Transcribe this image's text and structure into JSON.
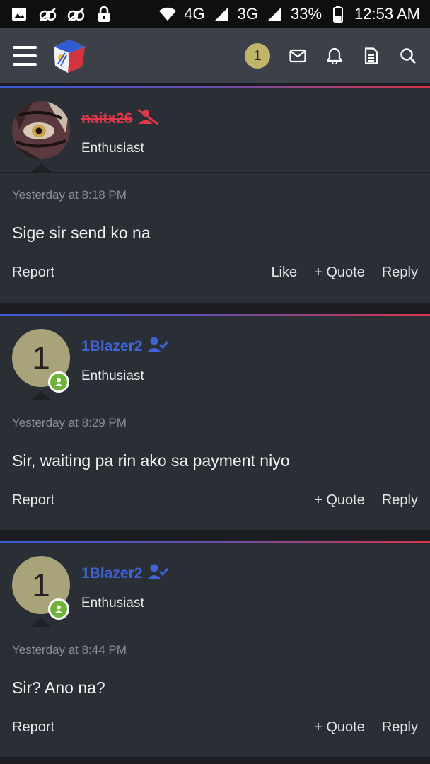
{
  "status_bar": {
    "network_4g": "4G",
    "network_3g": "3G",
    "battery": "33%",
    "time": "12:53 AM"
  },
  "header": {
    "notification_count": "1"
  },
  "posts": [
    {
      "username": "naitx26",
      "user_title": "Enthusiast",
      "timestamp": "Yesterday at 8:18 PM",
      "message": "Sige sir send ko na",
      "report": "Report",
      "like": "Like",
      "quote": "+ Quote",
      "reply": "Reply"
    },
    {
      "username": "1Blazer2",
      "avatar_letter": "1",
      "user_title": "Enthusiast",
      "timestamp": "Yesterday at 8:29 PM",
      "message": "Sir, waiting pa rin ako sa payment niyo",
      "report": "Report",
      "quote": "+ Quote",
      "reply": "Reply"
    },
    {
      "username": "1Blazer2",
      "avatar_letter": "1",
      "user_title": "Enthusiast",
      "timestamp": "Yesterday at 8:44 PM",
      "message": "Sir? Ano na?",
      "report": "Report",
      "quote": "+ Quote",
      "reply": "Reply"
    }
  ],
  "colors": {
    "banned_user": "#e0384a",
    "verified_user": "#3f63d8",
    "online": "#6fb33b",
    "badge": "#bfb66a"
  }
}
